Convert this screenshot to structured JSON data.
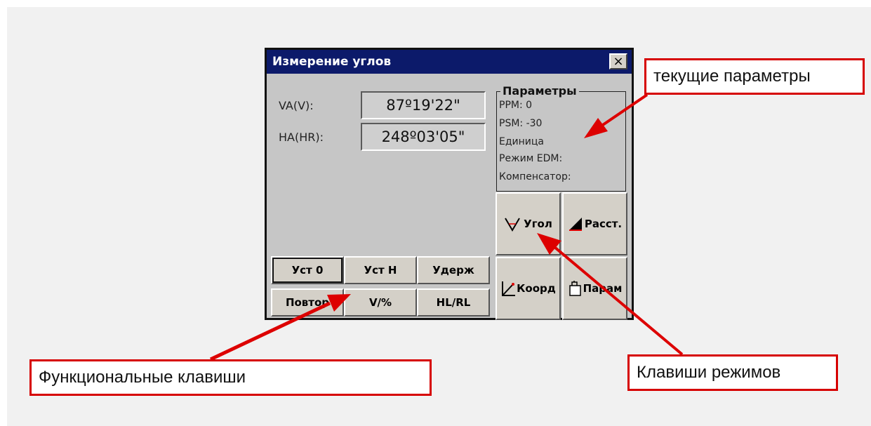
{
  "window": {
    "title": "Измерение углов",
    "close_label": "×"
  },
  "readings": {
    "va_label": "VA(V):",
    "va_value": "87º19'22\"",
    "ha_label": "HA(HR):",
    "ha_value": "248º03'05\""
  },
  "parameters": {
    "title": "Параметры",
    "lines": [
      "PPM:   0",
      "PSM: -30",
      "Единица",
      "Режим EDM:",
      "Компенсатор:"
    ]
  },
  "function_keys": [
    {
      "label": "Уст 0",
      "active": true
    },
    {
      "label": "Уст Н"
    },
    {
      "label": "Удерж"
    },
    {
      "label": "Повтор"
    },
    {
      "label": "V/%"
    },
    {
      "label": "HL/RL"
    }
  ],
  "mode_keys": [
    {
      "label": "Угол",
      "icon": "angle-icon"
    },
    {
      "label": "Расст.",
      "icon": "distance-icon"
    },
    {
      "label": "Коорд",
      "icon": "coordinates-icon"
    },
    {
      "label": "Парам",
      "icon": "parameters-icon"
    }
  ],
  "annotations": {
    "current_params": "текущие параметры",
    "function_keys": "Функциональные клавиши",
    "mode_keys": "Клавиши режимов"
  },
  "colors": {
    "titlebar": "#0c1a6a",
    "callout_border": "#d60000",
    "arrow": "#dd0000"
  }
}
